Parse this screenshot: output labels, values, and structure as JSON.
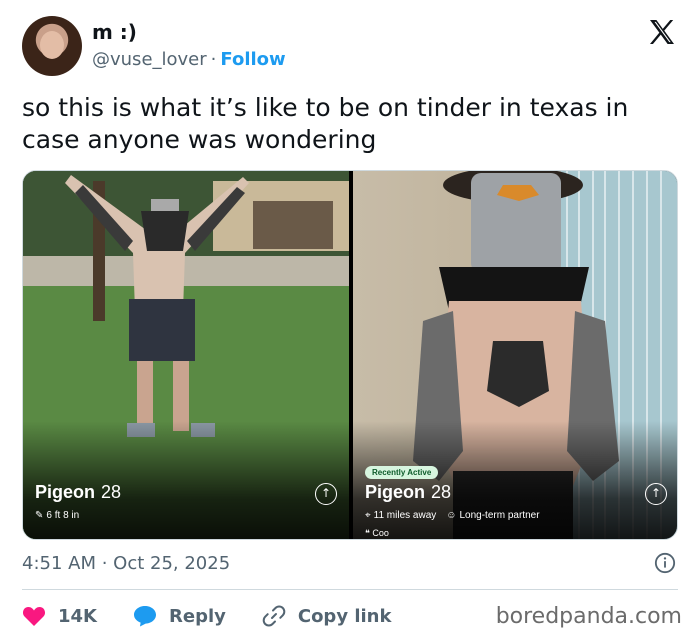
{
  "user": {
    "display_name": "m :)",
    "handle": "@vuse_lover",
    "separator": "·",
    "follow_label": "Follow"
  },
  "tweet": {
    "text": "so this is what it’s like to be on tinder in texas in case anyone was wondering",
    "timestamp": "4:51 AM · Oct 25, 2025"
  },
  "cards": [
    {
      "name": "Pigeon",
      "age": "28",
      "height": "6 ft 8 in"
    },
    {
      "badge": "Recently Active",
      "name": "Pigeon",
      "age": "28",
      "distance": "11 miles away",
      "intent": "Long-term partner",
      "bio": "Coo"
    }
  ],
  "actions": {
    "likes": "14K",
    "reply_label": "Reply",
    "copy_label": "Copy link"
  },
  "watermark": "boredpanda.com",
  "colors": {
    "accent": "#1d9bf0",
    "like": "#f91880",
    "secondary_text": "#536471"
  },
  "icons": [
    "x-logo-icon",
    "link-icon",
    "ruler-icon",
    "location-icon",
    "info-icon",
    "heart-icon",
    "reply-bubble-icon",
    "quote-icon"
  ]
}
